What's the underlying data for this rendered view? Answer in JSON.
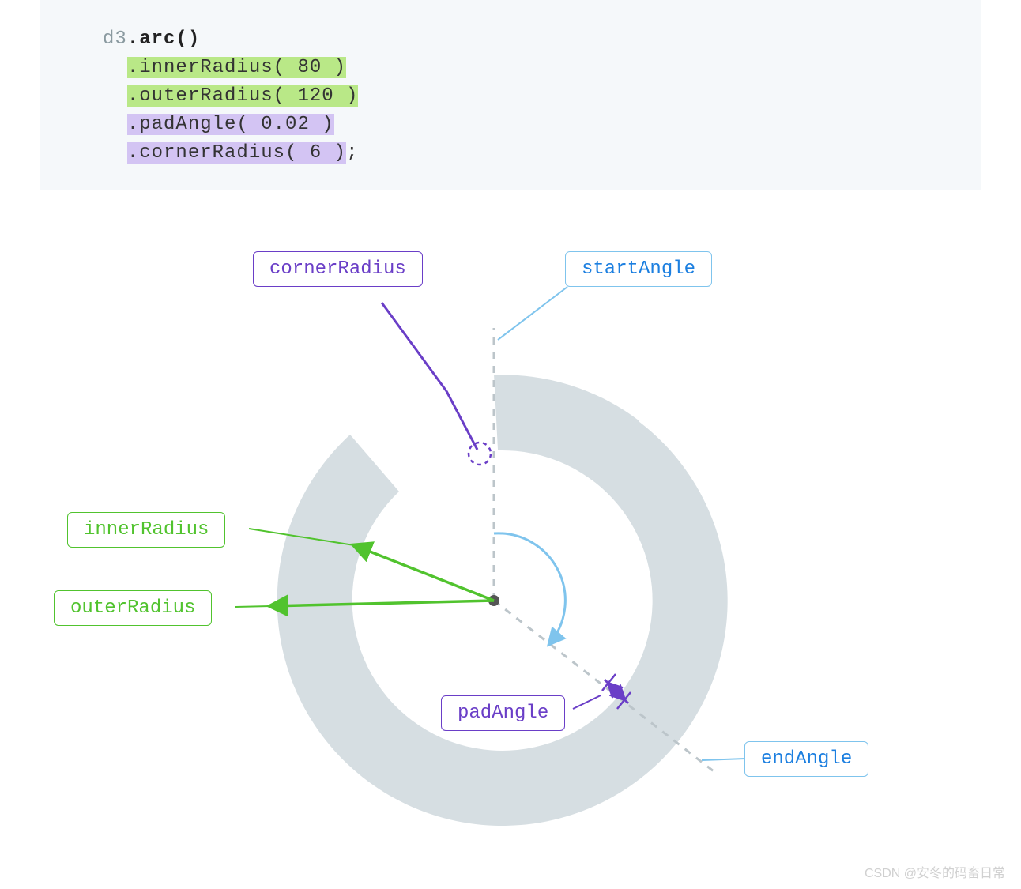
{
  "code": {
    "prefix": "d3",
    "call": ".arc()",
    "line1": ".innerRadius( 80 )",
    "line2": ".outerRadius( 120 )",
    "line3": ".padAngle( 0.02 )",
    "line4_hl": ".cornerRadius( 6 )",
    "line4_tail": ";"
  },
  "labels": {
    "cornerRadius": "cornerRadius",
    "startAngle": "startAngle",
    "innerRadius": "innerRadius",
    "outerRadius": "outerRadius",
    "padAngle": "padAngle",
    "endAngle": "endAngle"
  },
  "colors": {
    "ring": "#d6dee2",
    "purple": "#6a3ec7",
    "blue": "#7fc4ed",
    "blueText": "#1c7fe0",
    "green": "#51c32e",
    "centerDot": "#555555"
  },
  "watermark": "CSDN @安冬的码畜日常",
  "diagram_data": {
    "type": "arc",
    "innerRadius": 80,
    "outerRadius": 120,
    "padAngle": 0.02,
    "cornerRadius": 6,
    "startAngle_deg": 0,
    "endAngle_deg_approx": 140,
    "annotations": [
      "cornerRadius",
      "startAngle",
      "innerRadius",
      "outerRadius",
      "padAngle",
      "endAngle"
    ]
  }
}
